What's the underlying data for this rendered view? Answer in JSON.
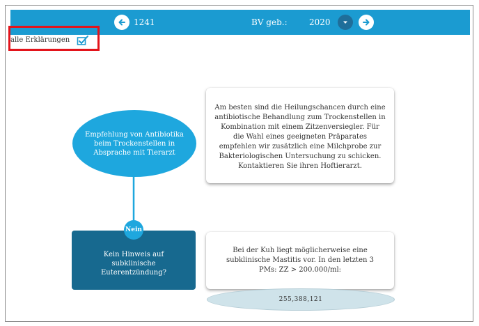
{
  "header": {
    "id_value": "1241",
    "bv_label": "BV geb.:",
    "year_value": "2020"
  },
  "explanations": {
    "label": "alle Erklärungen"
  },
  "flow": {
    "recommendation_node": "Empfehlung von Antibiotika beim Trockenstellen in Absprache mit Tierarzt",
    "recommendation_text": "Am besten sind die Heilungschancen durch eine antibiotische Behandlung zum Trockenstellen in Kombination mit einem Zitzenversiegler. Für die Wahl eines geeigneten Präparates empfehlen wir zusätzlich eine Milchprobe zur Bakteriologischen Untersuchung zu schicken. Kontaktieren Sie ihren Hoftierarzt.",
    "decision_node": "Kein Hinweis auf subklinische Euterentzündung?",
    "nein_label": "Nein",
    "info_text": "Bei der Kuh liegt möglicherweise eine subklinische Mastitis vor. In den letzten 3 PMs: ZZ > 200.000/ml:",
    "values": "255,388,121"
  },
  "colors": {
    "topbar": "#1b9bd1",
    "ellipse": "#1ea7de",
    "decision": "#17698f",
    "highlight": "#e3141b"
  }
}
